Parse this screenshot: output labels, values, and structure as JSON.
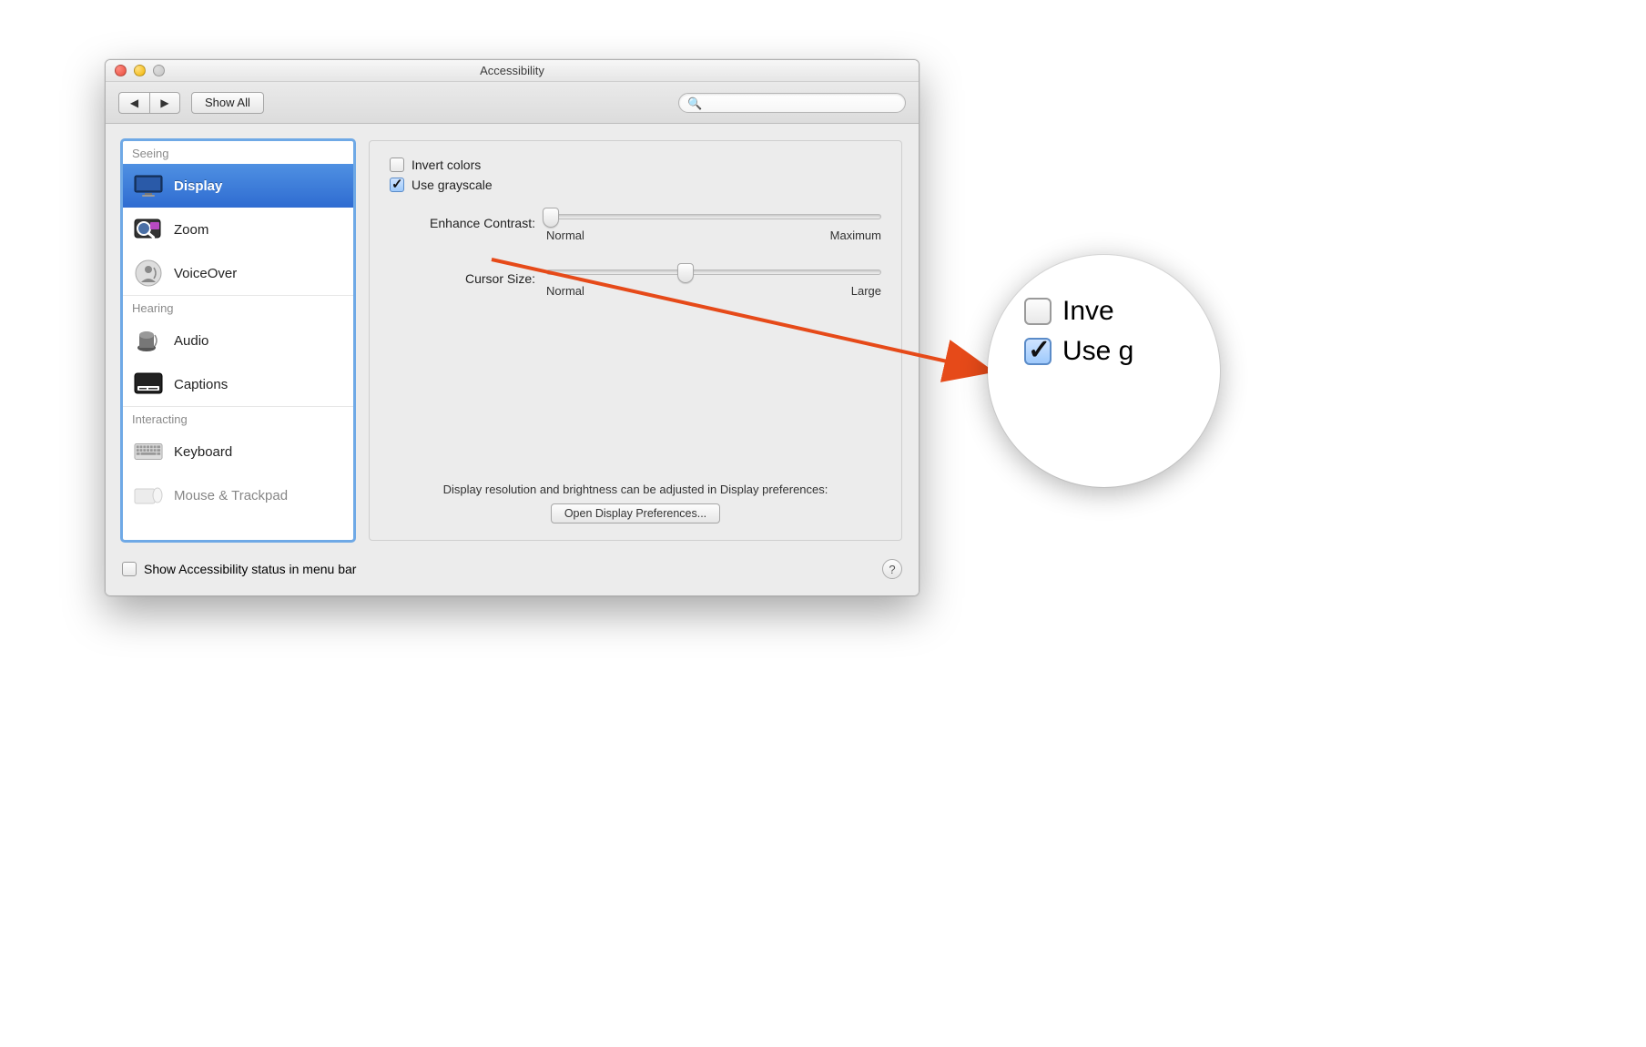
{
  "window": {
    "title": "Accessibility"
  },
  "toolbar": {
    "show_all": "Show All",
    "search_placeholder": ""
  },
  "sidebar": {
    "sections": {
      "seeing": "Seeing",
      "hearing": "Hearing",
      "interacting": "Interacting"
    },
    "items": {
      "display": "Display",
      "zoom": "Zoom",
      "voiceover": "VoiceOver",
      "audio": "Audio",
      "captions": "Captions",
      "keyboard": "Keyboard",
      "mouse": "Mouse & Trackpad"
    }
  },
  "panel": {
    "invert_colors": "Invert colors",
    "use_grayscale": "Use grayscale",
    "enhance_contrast": "Enhance Contrast:",
    "cursor_size": "Cursor Size:",
    "normal": "Normal",
    "maximum": "Maximum",
    "large": "Large",
    "resolution_note": "Display resolution and brightness can be adjusted in Display preferences:",
    "open_display_prefs": "Open Display Preferences..."
  },
  "footer": {
    "status_in_menubar": "Show Accessibility status in menu bar"
  },
  "lens": {
    "invert_fragment": "Inve",
    "use_fragment": "Use g"
  }
}
